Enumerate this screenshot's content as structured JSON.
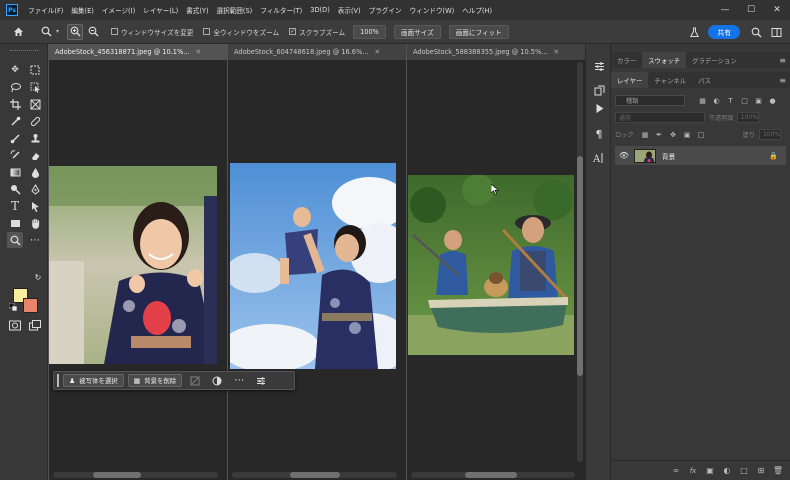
{
  "menubar": {
    "logo": "Ps",
    "items": [
      "ファイル(F)",
      "編集(E)",
      "イメージ(I)",
      "レイヤー(L)",
      "書式(Y)",
      "選択範囲(S)",
      "フィルター(T)",
      "3D(D)",
      "表示(V)",
      "プラグイン",
      "ウィンドウ(W)",
      "ヘルプ(H)"
    ],
    "window_controls": [
      "minimize-icon",
      "maximize-icon",
      "close-icon"
    ]
  },
  "options": {
    "resize_windows_label": "ウィンドウサイズを変更",
    "resize_windows_checked": false,
    "zoom_all_label": "全ウィンドウをズーム",
    "zoom_all_checked": false,
    "scrubby_zoom_label": "スクラブズーム",
    "scrubby_zoom_checked": true,
    "zoom_100_label": "100%",
    "fit_screen_label": "画面サイズ",
    "fill_screen_label": "画面にフィット",
    "share_label": "共有"
  },
  "documents": [
    {
      "tab": "AdobeStock_456318871.jpeg @ 10.1%...",
      "active": true
    },
    {
      "tab": "AdobeStock_604748618.jpeg @ 16.6%...",
      "active": false
    },
    {
      "tab": "AdobeStock_588388355.jpeg @ 10.5%...",
      "active": false
    }
  ],
  "taskbar": {
    "select_subject": "被写体を選択",
    "remove_background": "背景を削除"
  },
  "panels": {
    "top_tabs": [
      "カラー",
      "スウォッチ",
      "グラデーション"
    ],
    "top_active": "スウォッチ",
    "layer_tabs": [
      "レイヤー",
      "チャンネル",
      "パス"
    ],
    "layer_active": "レイヤー",
    "filter_kind": "種類",
    "blend_mode": "通常",
    "opacity_label": "不透明度",
    "opacity_value": "100%",
    "lock_label": "ロック",
    "fill_label": "塗り",
    "fill_value": "100%",
    "layer_name": "背景"
  },
  "colors": {
    "foreground": "#f9ee9e",
    "background": "#e8836c",
    "accent": "#1473e6"
  }
}
